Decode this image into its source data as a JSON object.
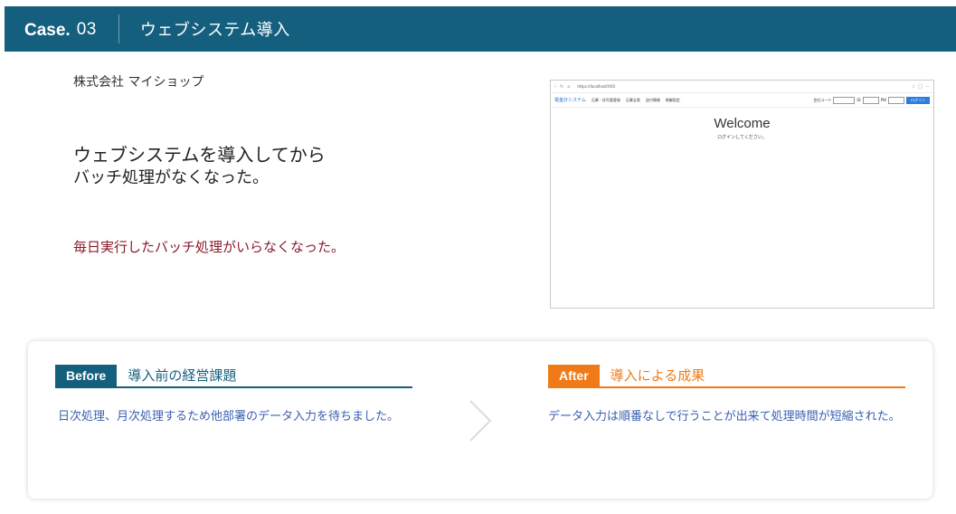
{
  "header": {
    "case_word": "Case.",
    "case_number": "03",
    "title": "ウェブシステム導入"
  },
  "company": "株式会社 マイショップ",
  "headline": {
    "line1": "ウェブシステムを導入してから",
    "line2": "バッチ処理がなくなった。"
  },
  "subtext": "毎日実行したバッチ処理がいらなくなった。",
  "screenshot": {
    "url": "https://localhost/XXX",
    "brand": "電金計システム",
    "nav_items": [
      "石膏・技写量登録",
      "石膏全表",
      "送付情報",
      "制御設定"
    ],
    "login_labels": [
      "会社コード",
      "ID",
      "PW"
    ],
    "login_button": "ログイン",
    "welcome": "Welcome",
    "welcome_sub": "ログインしてください。"
  },
  "before": {
    "tag": "Before",
    "title": "導入前の経営課題",
    "text": "日次処理、月次処理するため他部署のデータ入力を待ちました。"
  },
  "after": {
    "tag": "After",
    "title": "導入による成果",
    "text": "データ入力は順番なしで行うことが出来て処理時間が短縮された。"
  },
  "colors": {
    "header_bg": "#155f7e",
    "accent_before": "#155f7e",
    "accent_after": "#f07a18",
    "subtext": "#8a1a2a",
    "body_text": "#3a5fb0"
  }
}
